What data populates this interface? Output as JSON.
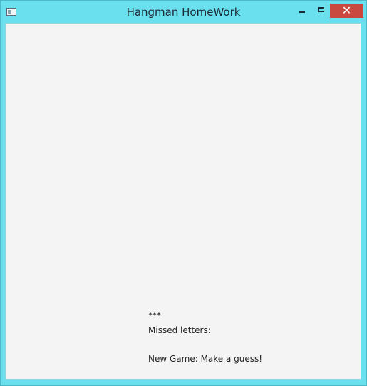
{
  "window": {
    "title": "Hangman HomeWork",
    "icons": {
      "app": "app-window-icon",
      "minimize": "minimize-icon",
      "maximize": "maximize-icon",
      "close": "close-icon"
    },
    "close_glyph": "✕",
    "colors": {
      "frame": "#6ae0ef",
      "close_button": "#c9483f",
      "client_background": "#f4f4f4"
    }
  },
  "game": {
    "word_display": "***",
    "missed_letters_label": "Missed letters:",
    "message": "New Game: Make a guess!"
  }
}
